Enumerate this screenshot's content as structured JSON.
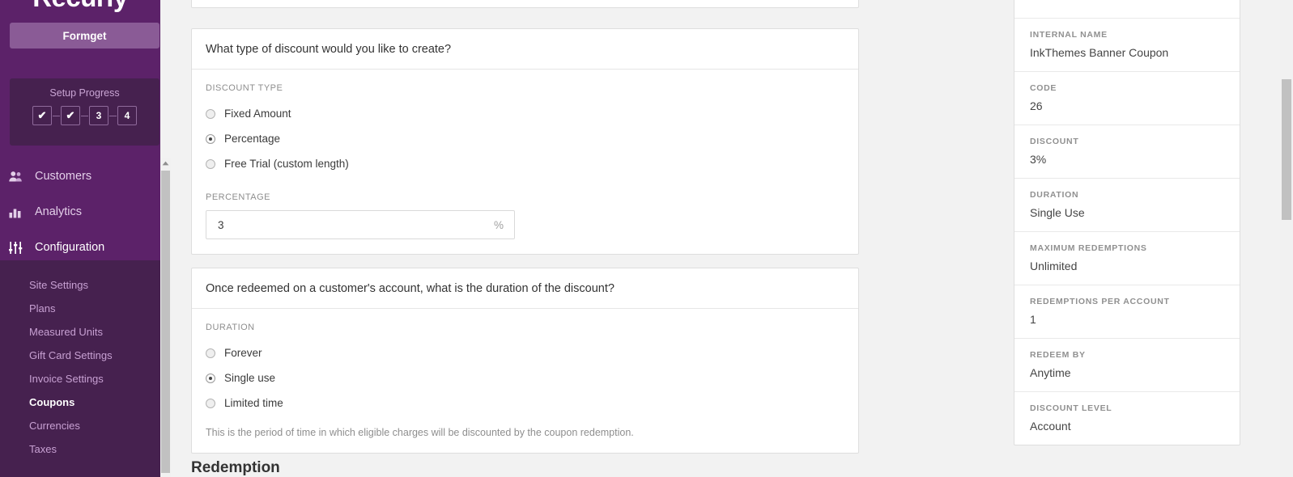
{
  "sidebar": {
    "brand": "Recurly",
    "account_button": "Formget",
    "setup": {
      "title": "Setup Progress",
      "steps": [
        {
          "label": "✔",
          "state": "complete"
        },
        {
          "label": "✔",
          "state": "complete"
        },
        {
          "label": "3",
          "state": "pending"
        },
        {
          "label": "4",
          "state": "pending"
        }
      ]
    },
    "nav": [
      {
        "label": "Customers",
        "icon": "users-icon",
        "active": false
      },
      {
        "label": "Analytics",
        "icon": "bar-chart-icon",
        "active": false
      },
      {
        "label": "Configuration",
        "icon": "sliders-icon",
        "active": true
      }
    ],
    "submenu": [
      {
        "label": "Site Settings",
        "current": false
      },
      {
        "label": "Plans",
        "current": false
      },
      {
        "label": "Measured Units",
        "current": false
      },
      {
        "label": "Gift Card Settings",
        "current": false
      },
      {
        "label": "Invoice Settings",
        "current": false
      },
      {
        "label": "Coupons",
        "current": true
      },
      {
        "label": "Currencies",
        "current": false
      },
      {
        "label": "Taxes",
        "current": false
      }
    ],
    "colors": {
      "background": "#5c2269",
      "submenu_background": "#46214f",
      "account_button": "#8a5b96",
      "text": "#e3cfe9"
    }
  },
  "main": {
    "discount_type_card": {
      "question": "What type of discount would you like to create?",
      "field_label": "DISCOUNT TYPE",
      "options": [
        {
          "label": "Fixed Amount",
          "selected": false
        },
        {
          "label": "Percentage",
          "selected": true
        },
        {
          "label": "Free Trial (custom length)",
          "selected": false
        }
      ],
      "percentage_label": "PERCENTAGE",
      "percentage_value": "3",
      "percentage_placeholder": "",
      "percentage_suffix": "%"
    },
    "duration_card": {
      "question": "Once redeemed on a customer's account, what is the duration of the discount?",
      "field_label": "DURATION",
      "options": [
        {
          "label": "Forever",
          "selected": false
        },
        {
          "label": "Single use",
          "selected": true
        },
        {
          "label": "Limited time",
          "selected": false
        }
      ],
      "help_text": "This is the period of time in which eligible charges will be discounted by the coupon redemption."
    },
    "next_section_heading": "Redemption"
  },
  "summary": {
    "rows": [
      {
        "label": "INTERNAL NAME",
        "value": "InkThemes Banner Coupon"
      },
      {
        "label": "CODE",
        "value": "26"
      },
      {
        "label": "DISCOUNT",
        "value": "3%"
      },
      {
        "label": "DURATION",
        "value": "Single Use"
      },
      {
        "label": "MAXIMUM REDEMPTIONS",
        "value": "Unlimited"
      },
      {
        "label": "REDEMPTIONS PER ACCOUNT",
        "value": "1"
      },
      {
        "label": "REDEEM BY",
        "value": "Anytime"
      },
      {
        "label": "DISCOUNT LEVEL",
        "value": "Account"
      }
    ]
  }
}
